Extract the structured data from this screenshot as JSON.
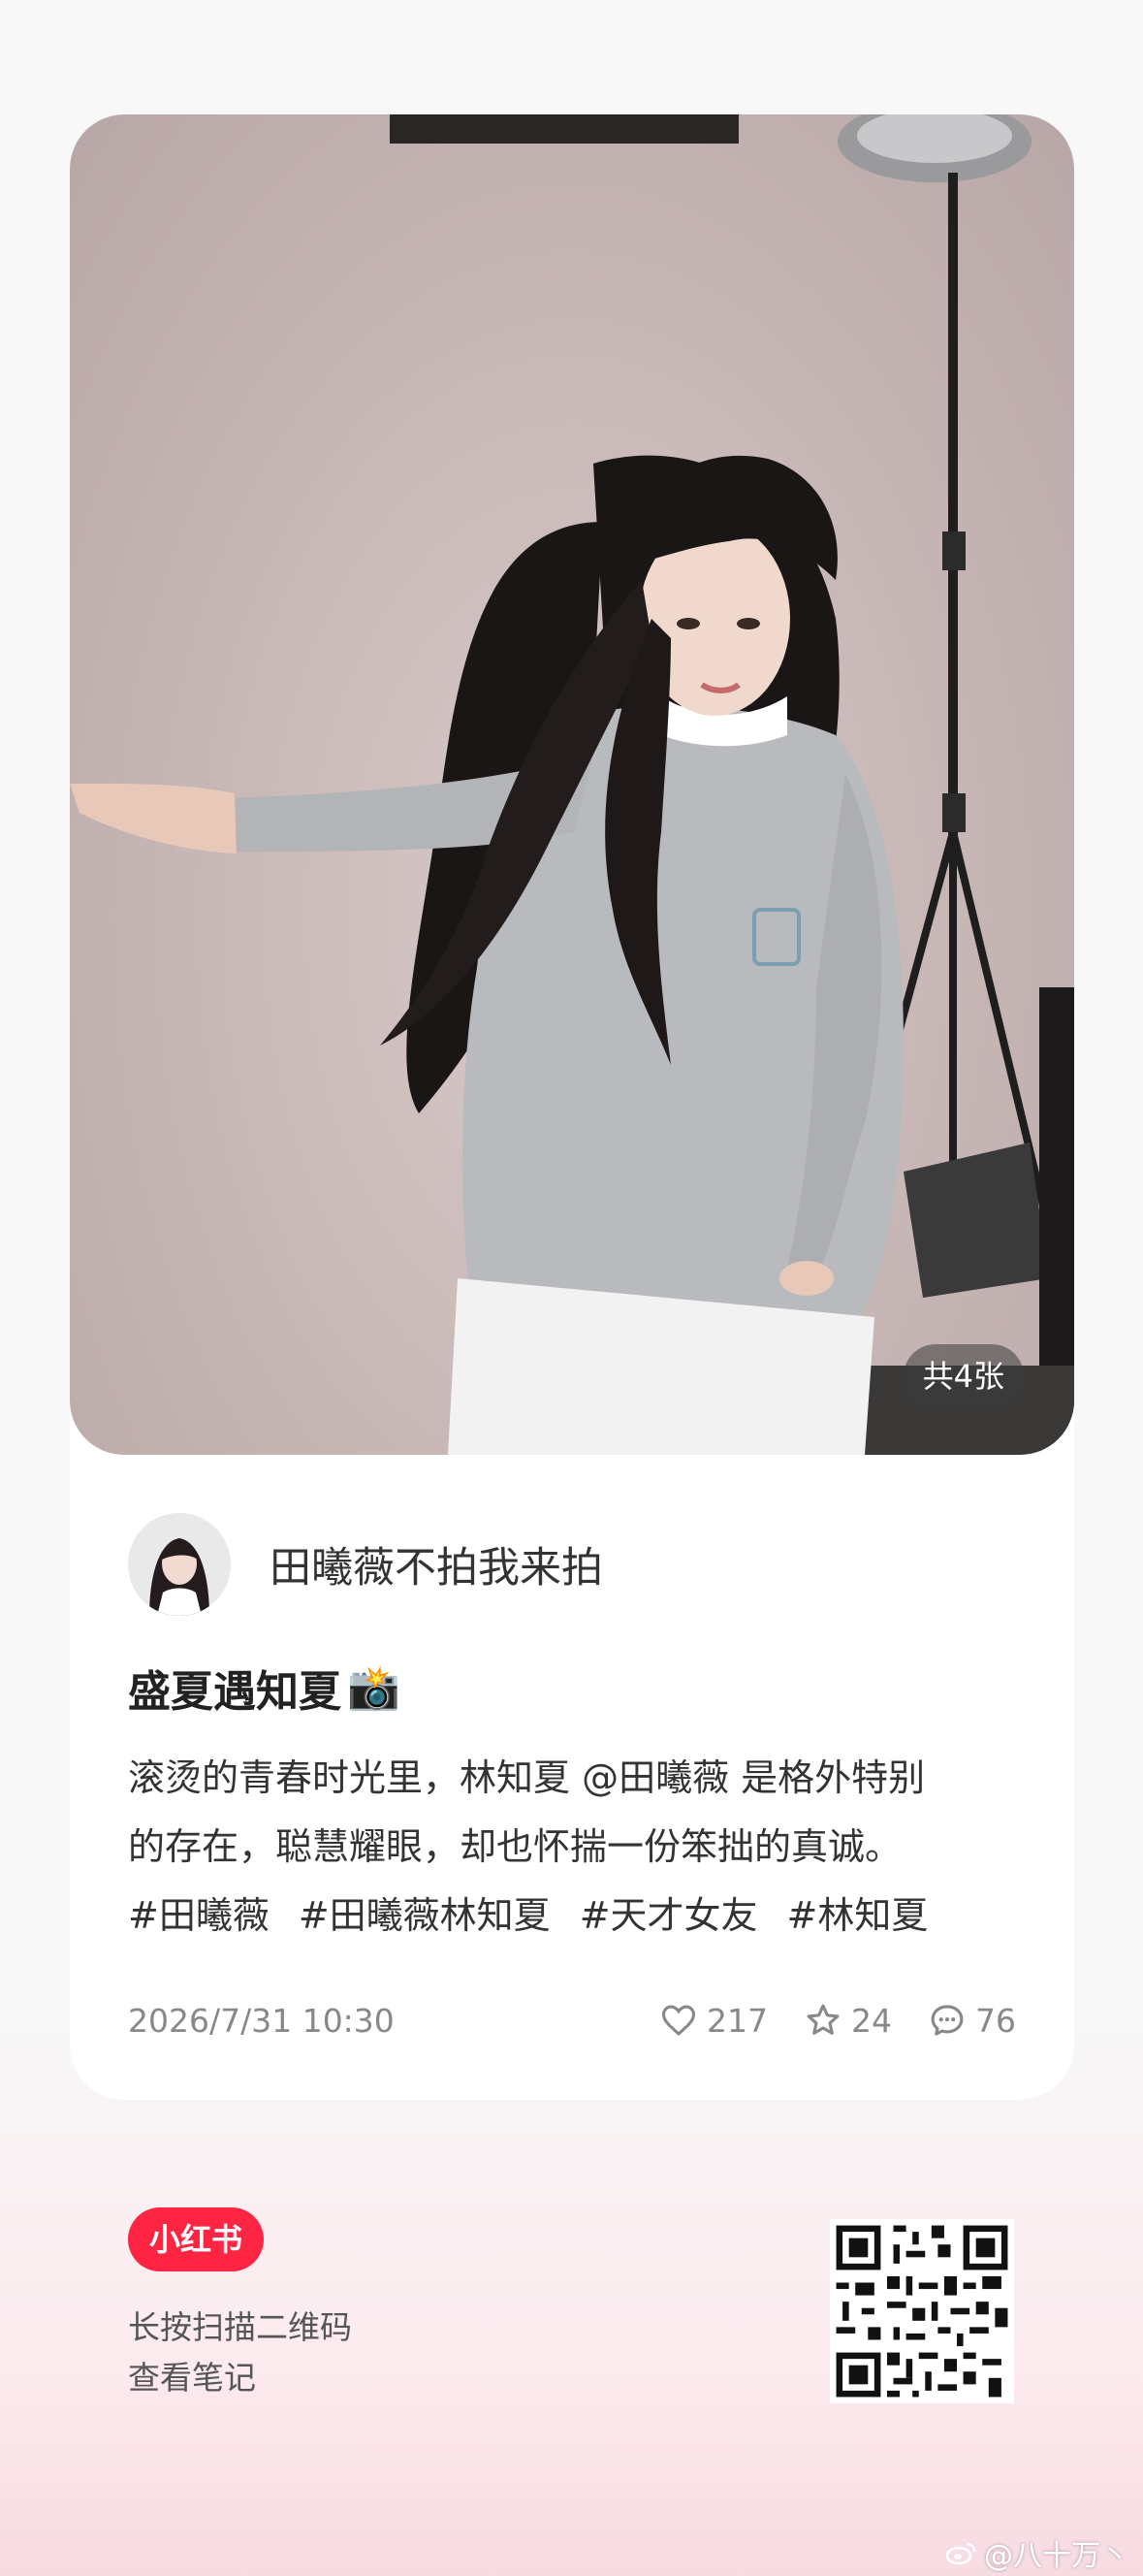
{
  "photo": {
    "count_label": "共4张"
  },
  "author": {
    "name": "田曦薇不拍我来拍"
  },
  "note": {
    "title": "盛夏遇知夏",
    "title_emoji": "📸",
    "desc_line1": "滚烫的青春时光里，林知夏 @田曦薇 是格外特别",
    "desc_line2": "的存在，聪慧耀眼，却也怀揣一份笨拙的真诚。",
    "tags": [
      "#田曦薇",
      "#田曦薇林知夏",
      "#天才女友",
      "#林知夏"
    ],
    "date": "2026/7/31 10:30",
    "likes": "217",
    "stars": "24",
    "comments": "76"
  },
  "footer": {
    "brand": "小红书",
    "hint_line1": "长按扫描二维码",
    "hint_line2": "查看笔记"
  },
  "watermark": {
    "text": "@八十万丶"
  },
  "colors": {
    "brand_red": "#ff2442",
    "page_bg": "#f8f8f8",
    "card_bg": "#ffffff"
  }
}
